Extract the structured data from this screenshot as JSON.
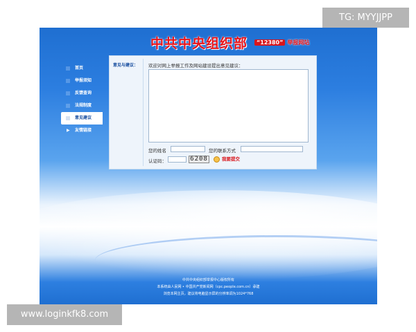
{
  "watermarks": {
    "top": "TG: MYYJJPP",
    "bottom": "www.loginkfk8.com"
  },
  "header": {
    "title": "中共中央组织部",
    "number": "“12380”",
    "subtitle": "举报网站"
  },
  "nav": {
    "items": [
      {
        "label": "首页",
        "icon": "grid-icon"
      },
      {
        "label": "举报须知",
        "icon": "grid-icon"
      },
      {
        "label": "反馈查询",
        "icon": "grid-icon"
      },
      {
        "label": "法规制度",
        "icon": "grid-icon"
      },
      {
        "label": "意见建议",
        "icon": "grid-icon",
        "active": true
      },
      {
        "label": "友情链接",
        "icon": "arrow-icon"
      }
    ]
  },
  "form": {
    "section_label": "意见与建议：",
    "prompt": "欢迎对网上举报工作及网站建设提出意见建议：",
    "textarea_value": "",
    "name_label": "您的姓名",
    "name_value": "",
    "contact_label": "您的联系方式",
    "contact_value": "",
    "captcha_label": "认证码：",
    "captcha_value": "",
    "captcha_code": "6208",
    "submit_label": "我要提交"
  },
  "footer": {
    "lines": [
      "中共中央组织部举报中心版权所有",
      "本系统由人民网 • 中国共产党新闻网（cpc.people.com.cn）承建",
      "浏览本网主页，建议将电脑显示屏的分辨率调为1024*768"
    ]
  },
  "colors": {
    "title_red": "#e8141b",
    "nav_active_text": "#1a4fa0",
    "site_blue": "#1f6fd1"
  }
}
